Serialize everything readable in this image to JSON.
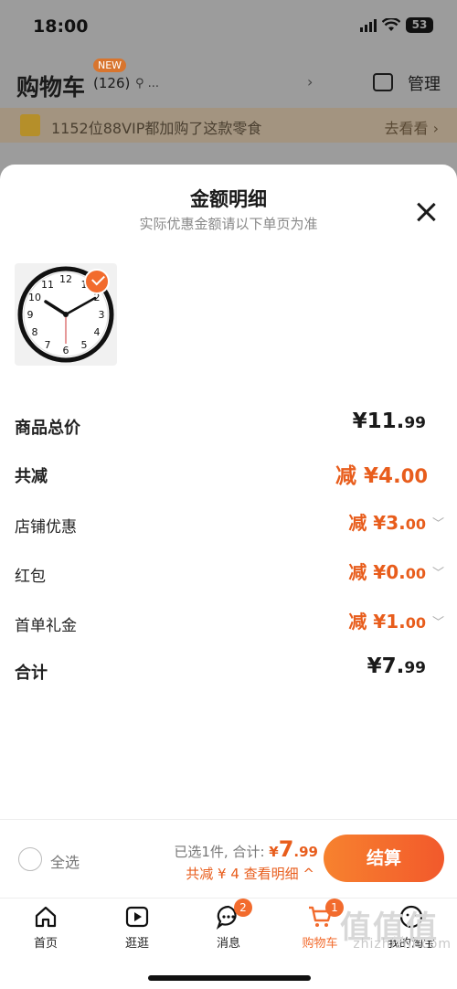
{
  "status_bar": {
    "time": "18:00",
    "battery": "53"
  },
  "cart_header": {
    "title": "购物车",
    "count": "(126)",
    "new_badge": "NEW",
    "location": "...",
    "manage": "管理"
  },
  "promo": {
    "text": "1152位88VIP都加购了这款零食",
    "link": "去看看"
  },
  "sheet": {
    "title": "金额明细",
    "subtitle": "实际优惠金额请以下单页为准",
    "rows": [
      {
        "label": "商品总价",
        "value": "¥11.",
        "cents": "99"
      },
      {
        "label": "共减",
        "value": "减 ¥4.",
        "cents": "00"
      },
      {
        "label": "店铺优惠",
        "value": "减 ¥3.",
        "cents": "00"
      },
      {
        "label": "红包",
        "value": "减 ¥0.",
        "cents": "00"
      },
      {
        "label": "首单礼金",
        "value": "减 ¥1.",
        "cents": "00"
      },
      {
        "label": "合计",
        "value": "¥7.",
        "cents": "99"
      }
    ]
  },
  "bottom_bar": {
    "select_all": "全选",
    "selected_text": "已选1件, 合计:",
    "total_prefix": "¥",
    "total_int": "7",
    "total_dec": ".99",
    "discount_text": "共减 ¥ 4  查看明细 ^",
    "checkout": "结算"
  },
  "tabs": [
    {
      "label": "首页",
      "icon": "home-icon"
    },
    {
      "label": "逛逛",
      "icon": "play-icon"
    },
    {
      "label": "消息",
      "icon": "message-icon",
      "badge": "2"
    },
    {
      "label": "购物车",
      "icon": "cart-icon",
      "badge": "1"
    },
    {
      "label": "我的淘宝",
      "icon": "profile-icon"
    }
  ],
  "watermark": {
    "big": "值",
    "small": "zhizhizhi.com"
  },
  "colors": {
    "accent": "#f26b2d",
    "discount": "#e85d1c"
  }
}
